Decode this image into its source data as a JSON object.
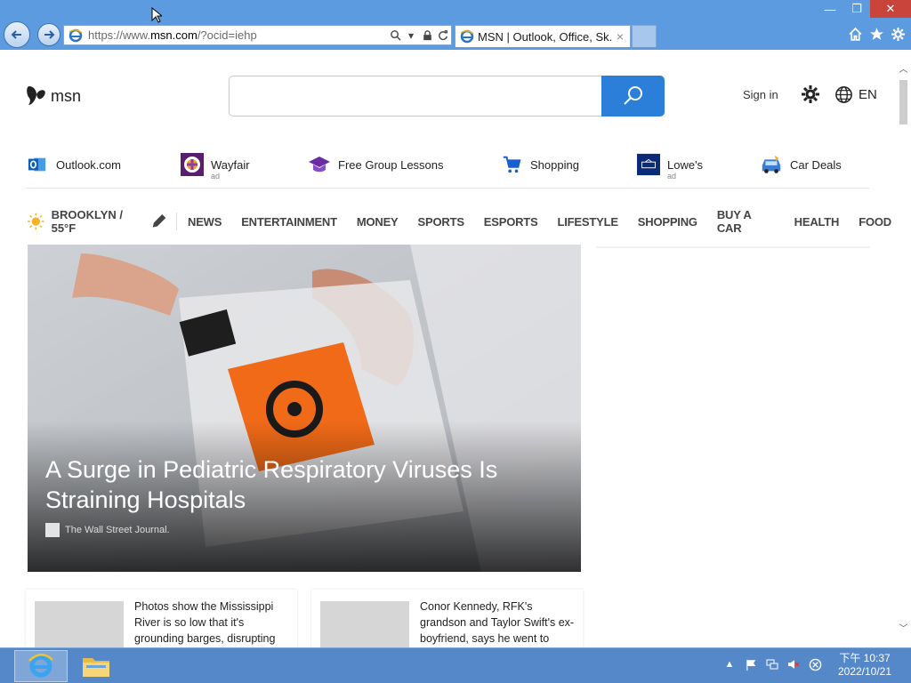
{
  "browser": {
    "url_host_prefix": "https://www.",
    "url_host": "msn.com",
    "url_path": "/?ocid=iehp",
    "tab_title": "MSN | Outlook, Office, Sk...",
    "tab_close": "×",
    "window_controls": {
      "minimize": "—",
      "restore": "❐",
      "close": "✕"
    }
  },
  "header": {
    "logo_text": "msn",
    "search_placeholder": "",
    "signin_label": "Sign in",
    "language": "EN"
  },
  "quicklinks": [
    {
      "label": "Outlook.com",
      "ad": "",
      "icon": "outlook-icon"
    },
    {
      "label": "Wayfair",
      "ad": "ad",
      "icon": "wayfair-icon"
    },
    {
      "label": "Free Group Lessons",
      "ad": "",
      "icon": "graduation-cap-icon"
    },
    {
      "label": "Shopping",
      "ad": "",
      "icon": "shopping-cart-icon"
    },
    {
      "label": "Lowe's",
      "ad": "ad",
      "icon": "lowes-icon"
    },
    {
      "label": "Car Deals",
      "ad": "",
      "icon": "car-icon"
    }
  ],
  "catnav": {
    "weather": "BROOKLYN / 55°F",
    "categories": [
      "NEWS",
      "ENTERTAINMENT",
      "MONEY",
      "SPORTS",
      "ESPORTS",
      "LIFESTYLE",
      "SHOPPING",
      "BUY A CAR",
      "HEALTH",
      "FOOD"
    ]
  },
  "hero": {
    "headline": "A Surge in Pediatric Respiratory Viruses Is Straining Hospitals",
    "source": "The Wall Street Journal."
  },
  "cards": [
    {
      "text": "Photos show the Mississippi River is so low that it's grounding barges, disrupting"
    },
    {
      "text": "Conor Kennedy, RFK's grandson and Taylor Swift's ex-boyfriend, says he went to"
    }
  ],
  "taskbar": {
    "clock_time": "下午 10:37",
    "clock_date": "2022/10/21"
  },
  "colors": {
    "chrome": "#5d9be0",
    "search_button": "#2b7fd8",
    "taskbar": "#5488c9"
  }
}
